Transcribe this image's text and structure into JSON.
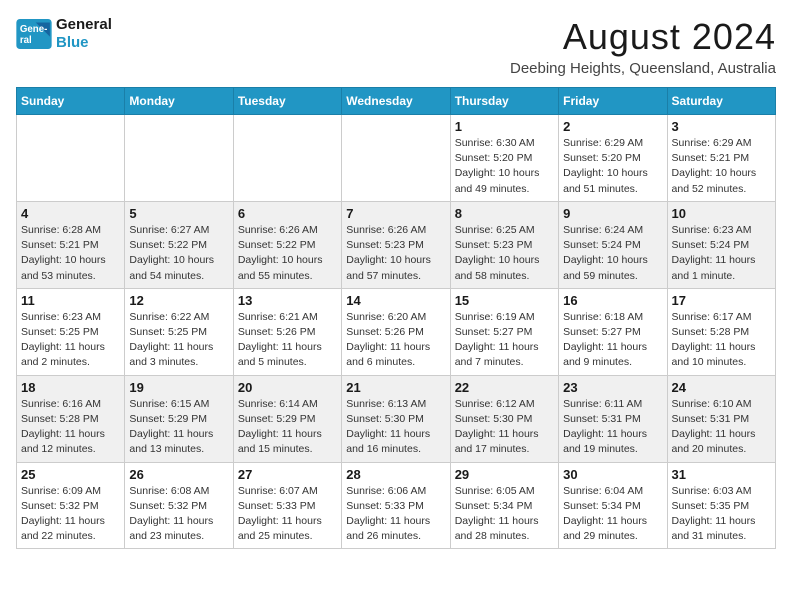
{
  "header": {
    "logo": {
      "line1": "General",
      "line2": "Blue"
    },
    "month": "August 2024",
    "location": "Deebing Heights, Queensland, Australia"
  },
  "days_of_week": [
    "Sunday",
    "Monday",
    "Tuesday",
    "Wednesday",
    "Thursday",
    "Friday",
    "Saturday"
  ],
  "weeks": [
    [
      {
        "day": "",
        "info": ""
      },
      {
        "day": "",
        "info": ""
      },
      {
        "day": "",
        "info": ""
      },
      {
        "day": "",
        "info": ""
      },
      {
        "day": "1",
        "info": "Sunrise: 6:30 AM\nSunset: 5:20 PM\nDaylight: 10 hours\nand 49 minutes."
      },
      {
        "day": "2",
        "info": "Sunrise: 6:29 AM\nSunset: 5:20 PM\nDaylight: 10 hours\nand 51 minutes."
      },
      {
        "day": "3",
        "info": "Sunrise: 6:29 AM\nSunset: 5:21 PM\nDaylight: 10 hours\nand 52 minutes."
      }
    ],
    [
      {
        "day": "4",
        "info": "Sunrise: 6:28 AM\nSunset: 5:21 PM\nDaylight: 10 hours\nand 53 minutes."
      },
      {
        "day": "5",
        "info": "Sunrise: 6:27 AM\nSunset: 5:22 PM\nDaylight: 10 hours\nand 54 minutes."
      },
      {
        "day": "6",
        "info": "Sunrise: 6:26 AM\nSunset: 5:22 PM\nDaylight: 10 hours\nand 55 minutes."
      },
      {
        "day": "7",
        "info": "Sunrise: 6:26 AM\nSunset: 5:23 PM\nDaylight: 10 hours\nand 57 minutes."
      },
      {
        "day": "8",
        "info": "Sunrise: 6:25 AM\nSunset: 5:23 PM\nDaylight: 10 hours\nand 58 minutes."
      },
      {
        "day": "9",
        "info": "Sunrise: 6:24 AM\nSunset: 5:24 PM\nDaylight: 10 hours\nand 59 minutes."
      },
      {
        "day": "10",
        "info": "Sunrise: 6:23 AM\nSunset: 5:24 PM\nDaylight: 11 hours\nand 1 minute."
      }
    ],
    [
      {
        "day": "11",
        "info": "Sunrise: 6:23 AM\nSunset: 5:25 PM\nDaylight: 11 hours\nand 2 minutes."
      },
      {
        "day": "12",
        "info": "Sunrise: 6:22 AM\nSunset: 5:25 PM\nDaylight: 11 hours\nand 3 minutes."
      },
      {
        "day": "13",
        "info": "Sunrise: 6:21 AM\nSunset: 5:26 PM\nDaylight: 11 hours\nand 5 minutes."
      },
      {
        "day": "14",
        "info": "Sunrise: 6:20 AM\nSunset: 5:26 PM\nDaylight: 11 hours\nand 6 minutes."
      },
      {
        "day": "15",
        "info": "Sunrise: 6:19 AM\nSunset: 5:27 PM\nDaylight: 11 hours\nand 7 minutes."
      },
      {
        "day": "16",
        "info": "Sunrise: 6:18 AM\nSunset: 5:27 PM\nDaylight: 11 hours\nand 9 minutes."
      },
      {
        "day": "17",
        "info": "Sunrise: 6:17 AM\nSunset: 5:28 PM\nDaylight: 11 hours\nand 10 minutes."
      }
    ],
    [
      {
        "day": "18",
        "info": "Sunrise: 6:16 AM\nSunset: 5:28 PM\nDaylight: 11 hours\nand 12 minutes."
      },
      {
        "day": "19",
        "info": "Sunrise: 6:15 AM\nSunset: 5:29 PM\nDaylight: 11 hours\nand 13 minutes."
      },
      {
        "day": "20",
        "info": "Sunrise: 6:14 AM\nSunset: 5:29 PM\nDaylight: 11 hours\nand 15 minutes."
      },
      {
        "day": "21",
        "info": "Sunrise: 6:13 AM\nSunset: 5:30 PM\nDaylight: 11 hours\nand 16 minutes."
      },
      {
        "day": "22",
        "info": "Sunrise: 6:12 AM\nSunset: 5:30 PM\nDaylight: 11 hours\nand 17 minutes."
      },
      {
        "day": "23",
        "info": "Sunrise: 6:11 AM\nSunset: 5:31 PM\nDaylight: 11 hours\nand 19 minutes."
      },
      {
        "day": "24",
        "info": "Sunrise: 6:10 AM\nSunset: 5:31 PM\nDaylight: 11 hours\nand 20 minutes."
      }
    ],
    [
      {
        "day": "25",
        "info": "Sunrise: 6:09 AM\nSunset: 5:32 PM\nDaylight: 11 hours\nand 22 minutes."
      },
      {
        "day": "26",
        "info": "Sunrise: 6:08 AM\nSunset: 5:32 PM\nDaylight: 11 hours\nand 23 minutes."
      },
      {
        "day": "27",
        "info": "Sunrise: 6:07 AM\nSunset: 5:33 PM\nDaylight: 11 hours\nand 25 minutes."
      },
      {
        "day": "28",
        "info": "Sunrise: 6:06 AM\nSunset: 5:33 PM\nDaylight: 11 hours\nand 26 minutes."
      },
      {
        "day": "29",
        "info": "Sunrise: 6:05 AM\nSunset: 5:34 PM\nDaylight: 11 hours\nand 28 minutes."
      },
      {
        "day": "30",
        "info": "Sunrise: 6:04 AM\nSunset: 5:34 PM\nDaylight: 11 hours\nand 29 minutes."
      },
      {
        "day": "31",
        "info": "Sunrise: 6:03 AM\nSunset: 5:35 PM\nDaylight: 11 hours\nand 31 minutes."
      }
    ]
  ]
}
